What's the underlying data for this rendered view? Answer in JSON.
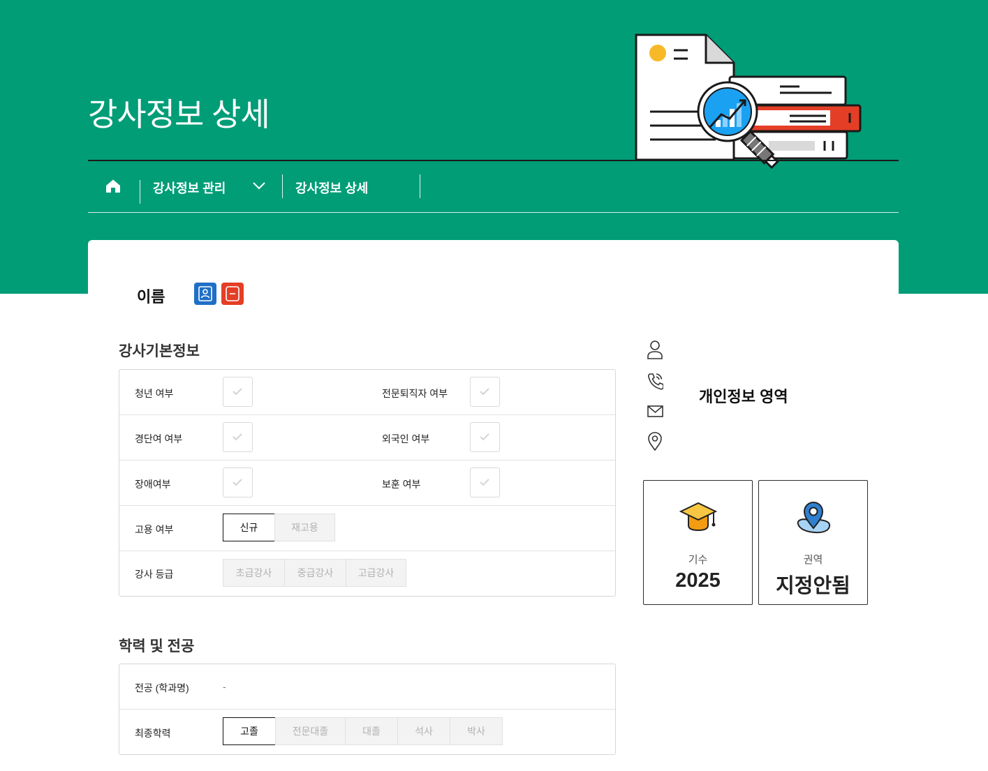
{
  "header": {
    "title": "강사정보 상세",
    "breadcrumb": {
      "home_icon": "home-icon",
      "level1": "강사정보 관리",
      "level2": "강사정보 상세"
    }
  },
  "profile": {
    "name_label": "이름",
    "icons": [
      "id-card-icon",
      "minus-square-icon"
    ]
  },
  "basic_info": {
    "title": "강사기본정보",
    "checks": [
      {
        "label": "청년 여부",
        "checked": false
      },
      {
        "label": "전문퇴직자 여부",
        "checked": false
      },
      {
        "label": "경단여 여부",
        "checked": false
      },
      {
        "label": "외국인 여부",
        "checked": false
      },
      {
        "label": "장애여부",
        "checked": false
      },
      {
        "label": "보훈 여부",
        "checked": false
      }
    ],
    "employment": {
      "label": "고용 여부",
      "options": [
        "신규",
        "재고용"
      ],
      "selected": "신규"
    },
    "grade": {
      "label": "강사 등급",
      "options": [
        "초급강사",
        "중급강사",
        "고급강사"
      ],
      "selected": ""
    }
  },
  "education": {
    "title": "학력 및 전공",
    "major": {
      "label": "전공 (학과명)",
      "value": "-"
    },
    "degree": {
      "label": "최종학력",
      "options": [
        "고졸",
        "전문대졸",
        "대졸",
        "석사",
        "박사"
      ],
      "selected": "고졸"
    }
  },
  "personal": {
    "label": "개인정보 영역",
    "icons": [
      "user-icon",
      "phone-icon",
      "mail-icon",
      "location-pin-icon"
    ]
  },
  "stats": [
    {
      "icon": "graduation-cap-icon",
      "label": "기수",
      "value": "2025"
    },
    {
      "icon": "map-pin-icon",
      "label": "권역",
      "value": "지정안됨"
    }
  ],
  "colors": {
    "brand": "#009d77",
    "blue": "#1f6fc6",
    "red": "#e43e26",
    "accent_yellow": "#f7b928"
  }
}
